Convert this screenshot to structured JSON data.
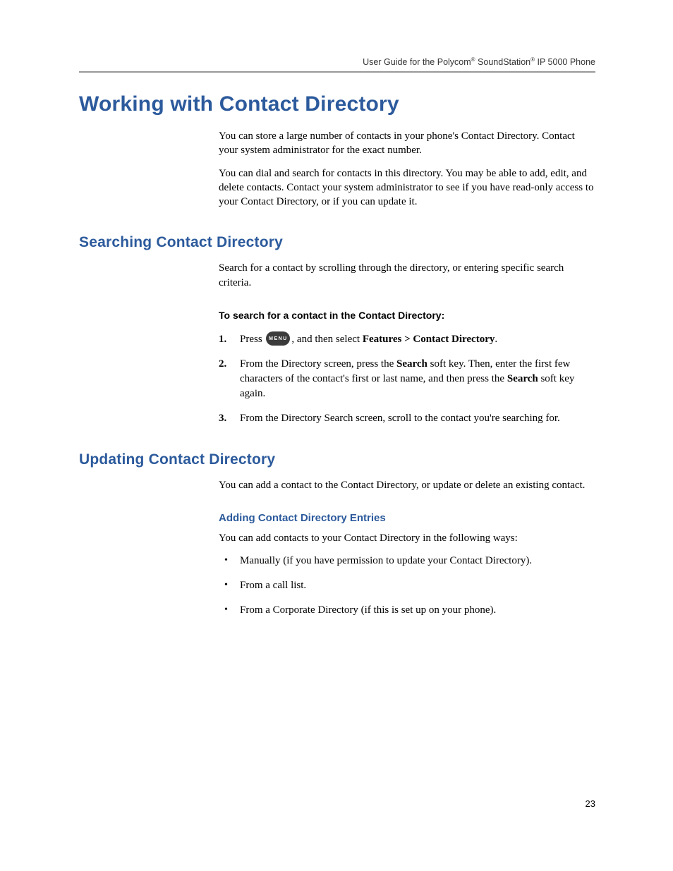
{
  "header": {
    "running_head_pre": "User Guide for the Polycom",
    "running_head_mid": " SoundStation",
    "running_head_post": " IP 5000 Phone",
    "reg": "®"
  },
  "h1": "Working with Contact Directory",
  "intro": {
    "p1": "You can store a large number of contacts in your phone's Contact Directory. Contact your system administrator for the exact number.",
    "p2": "You can dial and search for contacts in this directory. You may be able to add, edit, and delete contacts. Contact your system administrator to see if you have read-only access to your Contact Directory, or if you can update it."
  },
  "searching": {
    "h2": "Searching Contact Directory",
    "p": "Search for a contact by scrolling through the directory, or entering specific search criteria.",
    "lead": "To search for a contact in the Contact Directory:",
    "step1": {
      "press": "Press ",
      "menu_label": "MENU",
      "after": ", and then select ",
      "features": "Features",
      "gt": " > ",
      "cd": "Contact Directory",
      "period": "."
    },
    "step2": {
      "a": "From the Directory screen, press the ",
      "b": "Search",
      "c": " soft key. Then, enter the first few characters of the contact's first or last name, and then press the ",
      "d": "Search",
      "e": " soft key again."
    },
    "step3": "From the Directory Search screen, scroll to the contact you're searching for."
  },
  "updating": {
    "h2": "Updating Contact Directory",
    "p": "You can add a contact to the Contact Directory, or update or delete an existing contact.",
    "h3": "Adding Contact Directory Entries",
    "p2": "You can add contacts to your Contact Directory in the following ways:",
    "bullets": {
      "b1": "Manually (if you have permission to update your Contact Directory).",
      "b2": "From a call list.",
      "b3": "From a Corporate Directory (if this is set up on your phone)."
    }
  },
  "page_number": "23"
}
